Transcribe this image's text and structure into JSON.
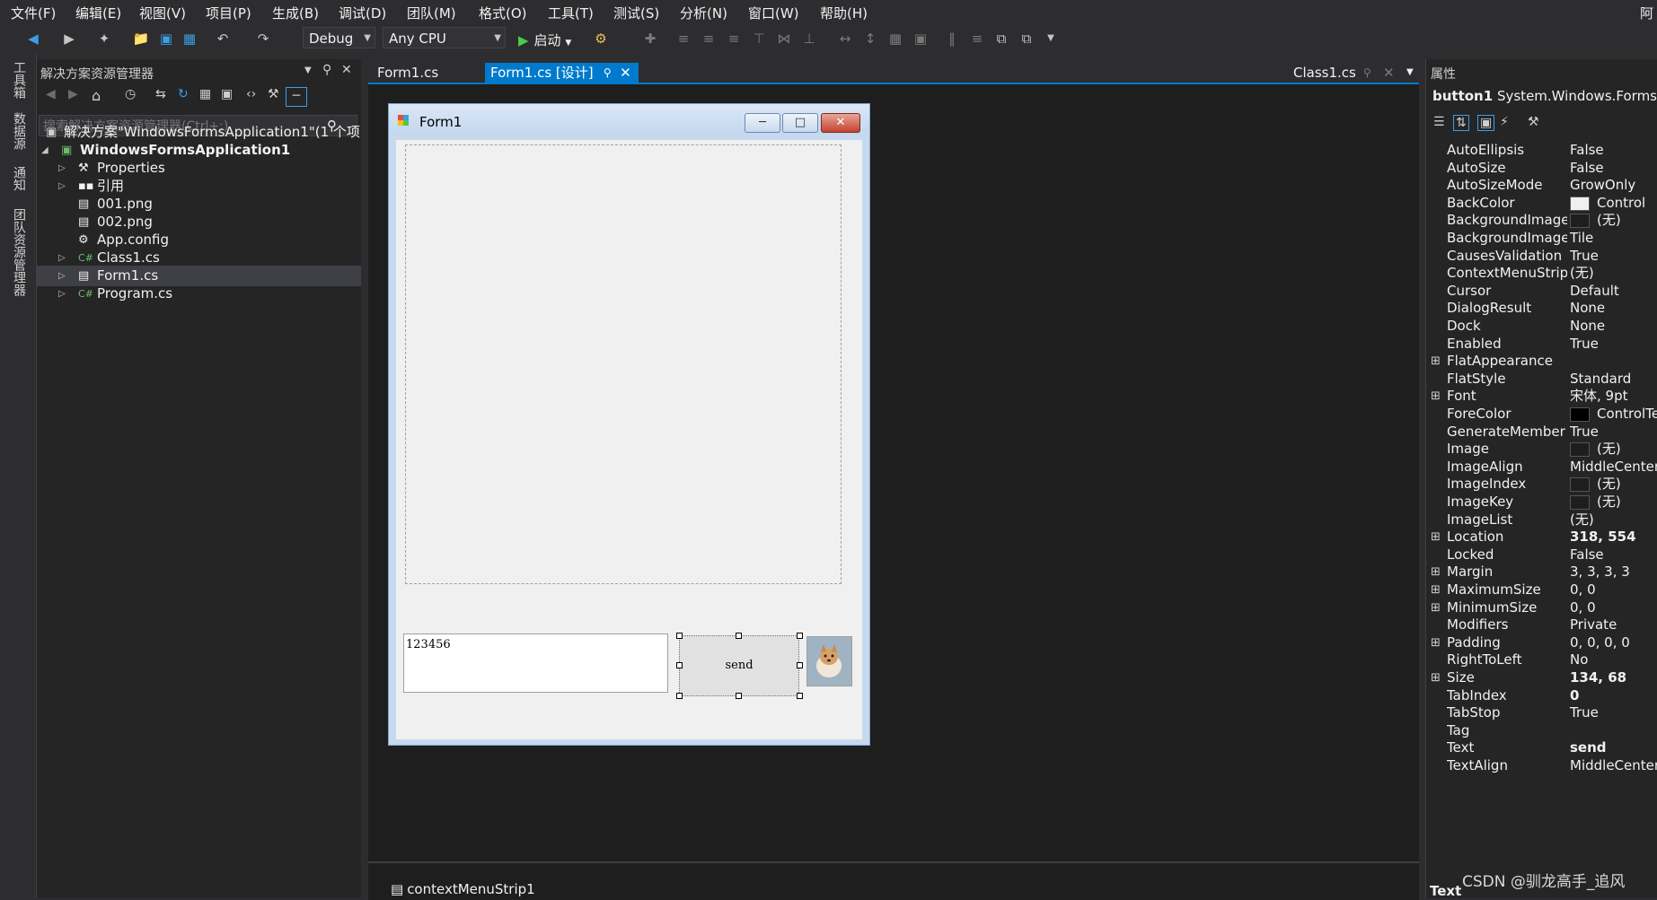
{
  "menu": [
    "文件(F)",
    "编辑(E)",
    "视图(V)",
    "项目(P)",
    "生成(B)",
    "调试(D)",
    "团队(M)",
    "格式(O)",
    "工具(T)",
    "测试(S)",
    "分析(N)",
    "窗口(W)",
    "帮助(H)"
  ],
  "menu_right": "阿",
  "toolbar": {
    "config": "Debug",
    "platform": "Any CPU",
    "start_label": "启动"
  },
  "vertical_tabs": [
    "工具箱",
    "数据源",
    "通知",
    "团队资源管理器"
  ],
  "solution_explorer": {
    "title": "解决方案资源管理器",
    "search_placeholder": "搜索解决方案资源管理器(Ctrl+;)",
    "items": [
      {
        "label": "解决方案\"WindowsFormsApplication1\"(1 个项",
        "icon": "solution-icon"
      },
      {
        "label": "WindowsFormsApplication1",
        "icon": "csharp-project-icon"
      },
      {
        "label": "Properties",
        "icon": "wrench-icon"
      },
      {
        "label": "引用",
        "icon": "references-icon"
      },
      {
        "label": "001.png",
        "icon": "image-file-icon"
      },
      {
        "label": "002.png",
        "icon": "image-file-icon"
      },
      {
        "label": "App.config",
        "icon": "config-file-icon"
      },
      {
        "label": "Class1.cs",
        "icon": "cs-file-icon"
      },
      {
        "label": "Form1.cs",
        "icon": "form-file-icon"
      },
      {
        "label": "Program.cs",
        "icon": "cs-file-icon"
      }
    ]
  },
  "doc_tabs": {
    "tab1": "Form1.cs",
    "tab2": "Form1.cs [设计]",
    "tab3": "Class1.cs"
  },
  "form": {
    "title": "Form1",
    "textbox_text": "123456",
    "button_text": "send"
  },
  "tray": {
    "item": "contextMenuStrip1"
  },
  "properties": {
    "title": "属性",
    "object_name": "button1",
    "object_type": "System.Windows.Forms.B",
    "rows": [
      {
        "name": "AutoEllipsis",
        "value": "False"
      },
      {
        "name": "AutoSize",
        "value": "False"
      },
      {
        "name": "AutoSizeMode",
        "value": "GrowOnly"
      },
      {
        "name": "BackColor",
        "value": "Control"
      },
      {
        "name": "BackgroundImage",
        "value": "(无)"
      },
      {
        "name": "BackgroundImage",
        "value": "Tile"
      },
      {
        "name": "CausesValidation",
        "value": "True"
      },
      {
        "name": "ContextMenuStrip",
        "value": "(无)"
      },
      {
        "name": "Cursor",
        "value": "Default"
      },
      {
        "name": "DialogResult",
        "value": "None"
      },
      {
        "name": "Dock",
        "value": "None"
      },
      {
        "name": "Enabled",
        "value": "True"
      },
      {
        "name": "FlatAppearance",
        "value": ""
      },
      {
        "name": "FlatStyle",
        "value": "Standard"
      },
      {
        "name": "Font",
        "value": "宋体, 9pt"
      },
      {
        "name": "ForeColor",
        "value": "ControlText"
      },
      {
        "name": "GenerateMember",
        "value": "True"
      },
      {
        "name": "Image",
        "value": "(无)"
      },
      {
        "name": "ImageAlign",
        "value": "MiddleCenter"
      },
      {
        "name": "ImageIndex",
        "value": "(无)"
      },
      {
        "name": "ImageKey",
        "value": "(无)"
      },
      {
        "name": "ImageList",
        "value": "(无)"
      },
      {
        "name": "Location",
        "value": "318, 554"
      },
      {
        "name": "Locked",
        "value": "False"
      },
      {
        "name": "Margin",
        "value": "3, 3, 3, 3"
      },
      {
        "name": "MaximumSize",
        "value": "0, 0"
      },
      {
        "name": "MinimumSize",
        "value": "0, 0"
      },
      {
        "name": "Modifiers",
        "value": "Private"
      },
      {
        "name": "Padding",
        "value": "0, 0, 0, 0"
      },
      {
        "name": "RightToLeft",
        "value": "No"
      },
      {
        "name": "Size",
        "value": "134, 68"
      },
      {
        "name": "TabIndex",
        "value": "0"
      },
      {
        "name": "TabStop",
        "value": "True"
      },
      {
        "name": "Tag",
        "value": ""
      },
      {
        "name": "Text",
        "value": "send"
      },
      {
        "name": "TextAlign",
        "value": "MiddleCenter"
      }
    ],
    "description_title": "Text"
  },
  "watermark": "CSDN @驯龙高手_追风",
  "colors": {
    "accent": "#007acc",
    "background": "#2d2d30",
    "panel": "#252526",
    "editor": "#1e1e1e"
  }
}
